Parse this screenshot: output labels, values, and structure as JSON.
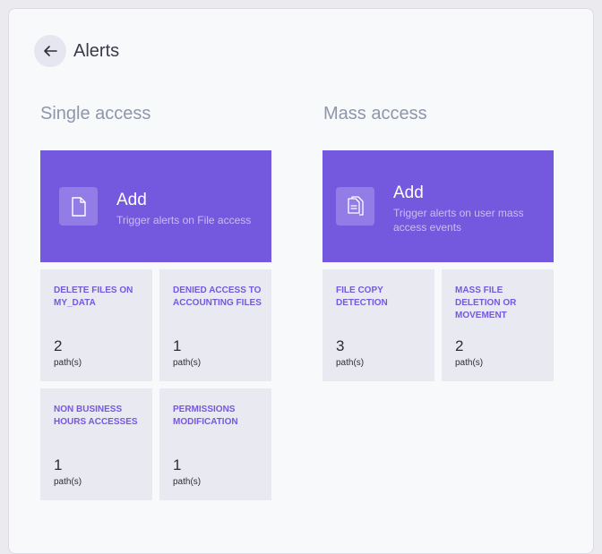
{
  "header": {
    "title": "Alerts",
    "back_icon": "arrow-left-icon"
  },
  "sections": [
    {
      "title": "Single access",
      "add": {
        "title": "Add",
        "subtitle": "Trigger alerts on File access",
        "icon": "file-icon"
      },
      "tiles": [
        {
          "label": "DELETE FILES ON MY_DATA",
          "count": "2",
          "unit": "path(s)"
        },
        {
          "label": "DENIED ACCESS TO ACCOUNTING FILES",
          "count": "1",
          "unit": "path(s)"
        },
        {
          "label": "NON BUSINESS HOURS ACCESSES",
          "count": "1",
          "unit": "path(s)"
        },
        {
          "label": "PERMISSIONS MODIFICATION",
          "count": "1",
          "unit": "path(s)"
        }
      ]
    },
    {
      "title": "Mass access",
      "add": {
        "title": "Add",
        "subtitle": "Trigger alerts on user mass access events",
        "icon": "files-copy-icon"
      },
      "tiles": [
        {
          "label": "FILE COPY DETECTION",
          "count": "3",
          "unit": "path(s)"
        },
        {
          "label": "MASS FILE DELETION OR MOVEMENT",
          "count": "2",
          "unit": "path(s)"
        }
      ]
    }
  ],
  "colors": {
    "accent": "#7459df",
    "tile_bg": "#e8e9f1",
    "section_title": "#8f95ab"
  }
}
